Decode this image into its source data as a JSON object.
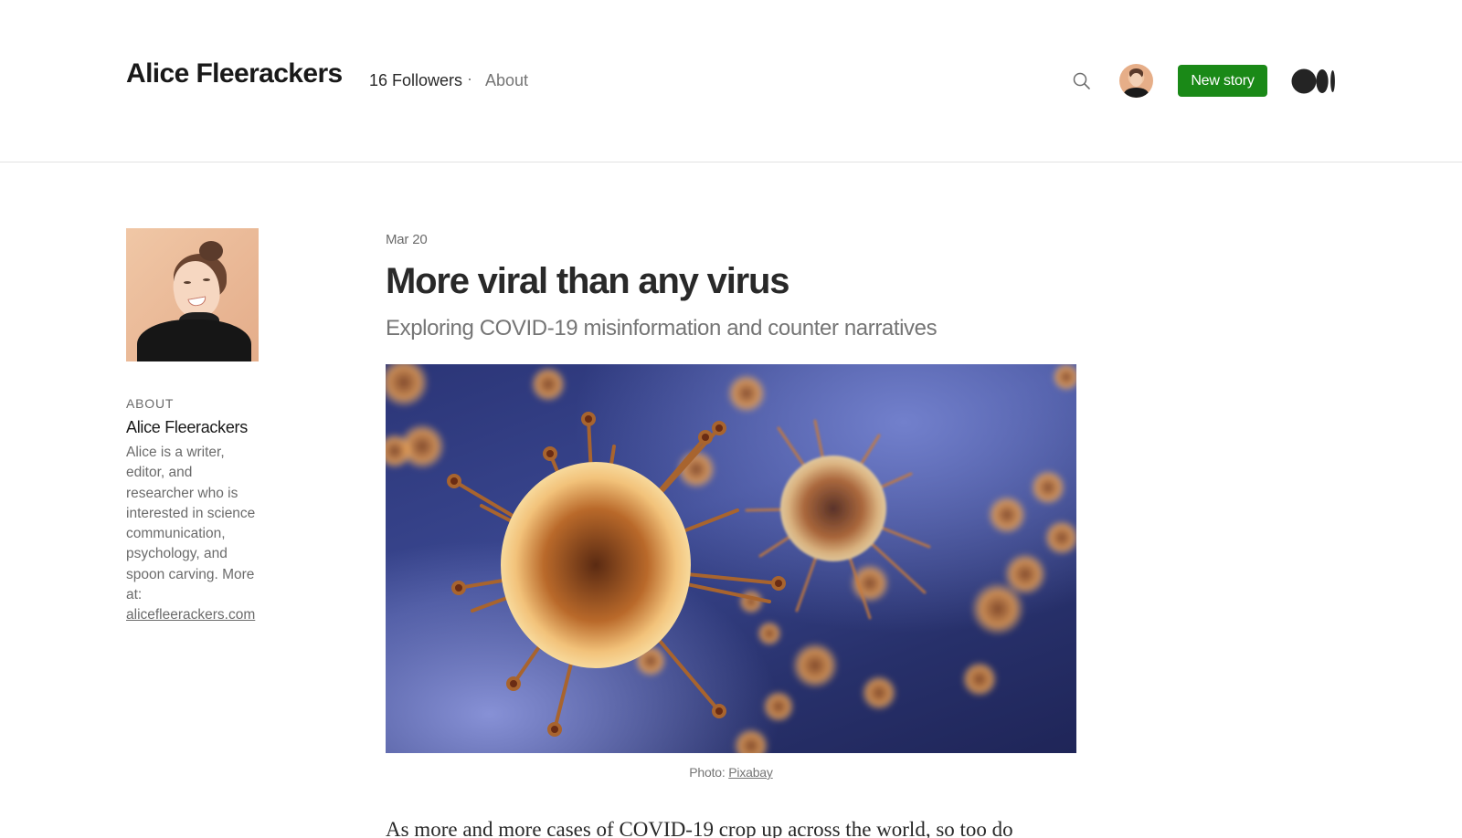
{
  "header": {
    "publication_name": "Alice Fleerackers",
    "followers": "16 Followers",
    "separator": "·",
    "about_link": "About",
    "new_story_label": "New story",
    "icons": {
      "search": "search-icon",
      "avatar": "user-avatar",
      "logo": "medium-logo"
    },
    "accent_color": "#1a8917"
  },
  "sidebar": {
    "about_label": "ABOUT",
    "author_name": "Alice Fleerackers",
    "bio": "Alice is a writer, editor, and researcher who is interested in science communication, psychology, and spoon carving. More at: ",
    "bio_link": "alicefleerackers.com"
  },
  "article": {
    "date": "Mar 20",
    "title": "More viral than any virus",
    "subtitle": "Exploring COVID-19 misinformation and counter narratives",
    "image_alt": "Coronavirus particles illustration",
    "caption_prefix": "Photo: ",
    "caption_link": "Pixabay",
    "first_line": "As more and more cases of COVID-19 crop up across the world, so too do"
  }
}
